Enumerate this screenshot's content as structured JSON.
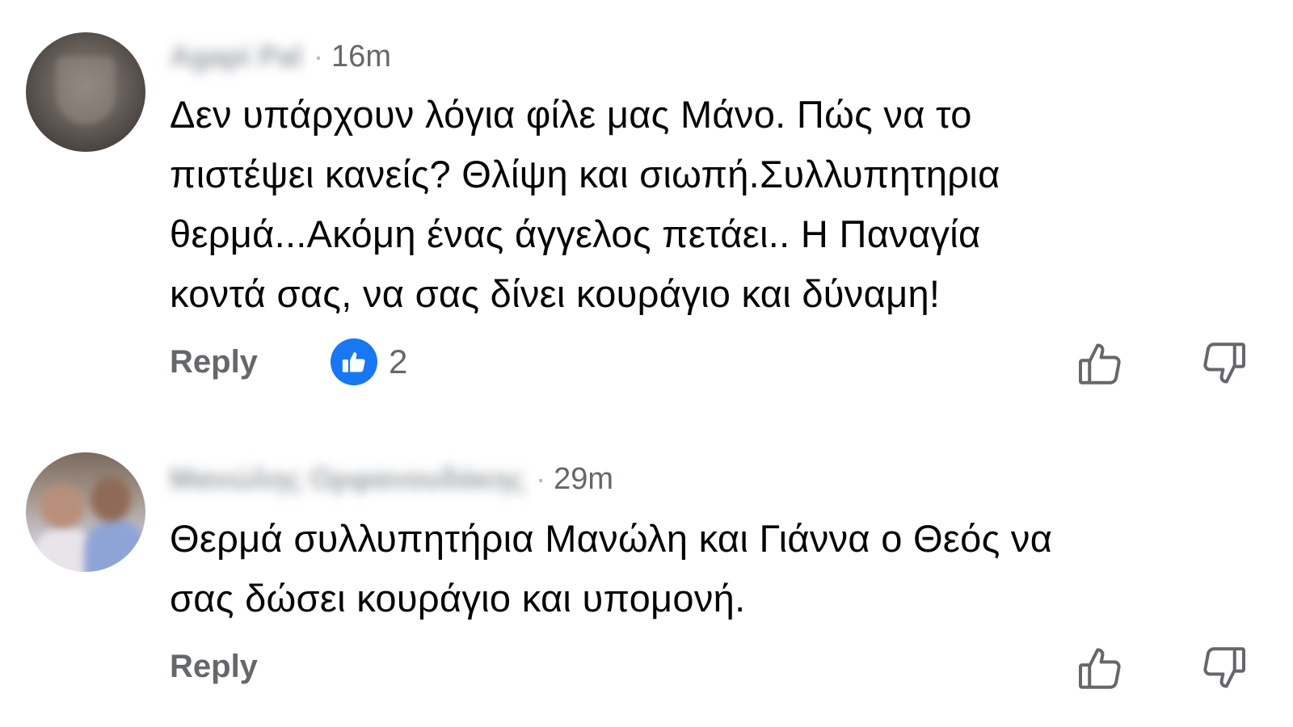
{
  "comments": [
    {
      "author": "Agapi Pal",
      "time": "16m",
      "text": "Δεν υπάρχουν λόγια φίλε μας Μάνο. Πώς να το\nπιστέψει κανείς? Θλίψη και σιωπή.Συλλυπητηρια\nθερμά...Ακόμη ένας άγγελος πετάει.. Η Παναγία\nκοντά σας, να σας δίνει κουράγιο  και δύναμη!",
      "reply_label": "Reply",
      "reaction_count": "2",
      "reaction_icon": "like-icon",
      "upvote_icon": "thumbs-up-outline-icon",
      "downvote_icon": "thumbs-down-outline-icon"
    },
    {
      "author": "Μανώλης Ορφανουδάκης",
      "time": "29m",
      "text": "Θερμά συλλυπητήρια Μανώλη και Γιάννα ο Θεός να\nσας δώσει κουράγιο και υπομονή.",
      "reply_label": "Reply",
      "upvote_icon": "thumbs-up-outline-icon",
      "downvote_icon": "thumbs-down-outline-icon"
    }
  ],
  "separator": "·",
  "colors": {
    "like_blue": "#1877f2",
    "meta_gray": "#65676b",
    "text": "#050505"
  }
}
